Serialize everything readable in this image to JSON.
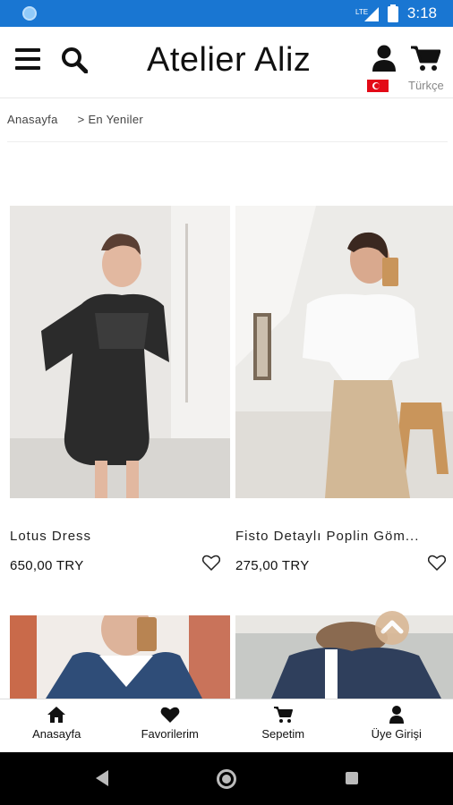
{
  "status_bar": {
    "time": "3:18",
    "network": "LTE",
    "accent": "#1976d2"
  },
  "header": {
    "brand": "Atelier Aliz",
    "language": "Türkçe",
    "icons": [
      "menu-icon",
      "search-icon",
      "user-icon",
      "cart-icon",
      "turkish-flag-icon"
    ]
  },
  "breadcrumb": {
    "home": "Anasayfa",
    "separator": ">",
    "current": "En Yeniler"
  },
  "products": [
    {
      "name": "Lotus Dress",
      "price": "650,00 TRY"
    },
    {
      "name": "Fisto Detaylı Poplin Göm...",
      "price": "275,00 TRY"
    }
  ],
  "bottom_nav": [
    {
      "label": "Anasayfa",
      "icon": "home-icon"
    },
    {
      "label": "Favorilerim",
      "icon": "heart-icon"
    },
    {
      "label": "Sepetim",
      "icon": "cart-icon"
    },
    {
      "label": "Üye Girişi",
      "icon": "user-icon"
    }
  ],
  "colors": {
    "scroll_button": "#d9b896",
    "flag_red": "#e30a17"
  }
}
